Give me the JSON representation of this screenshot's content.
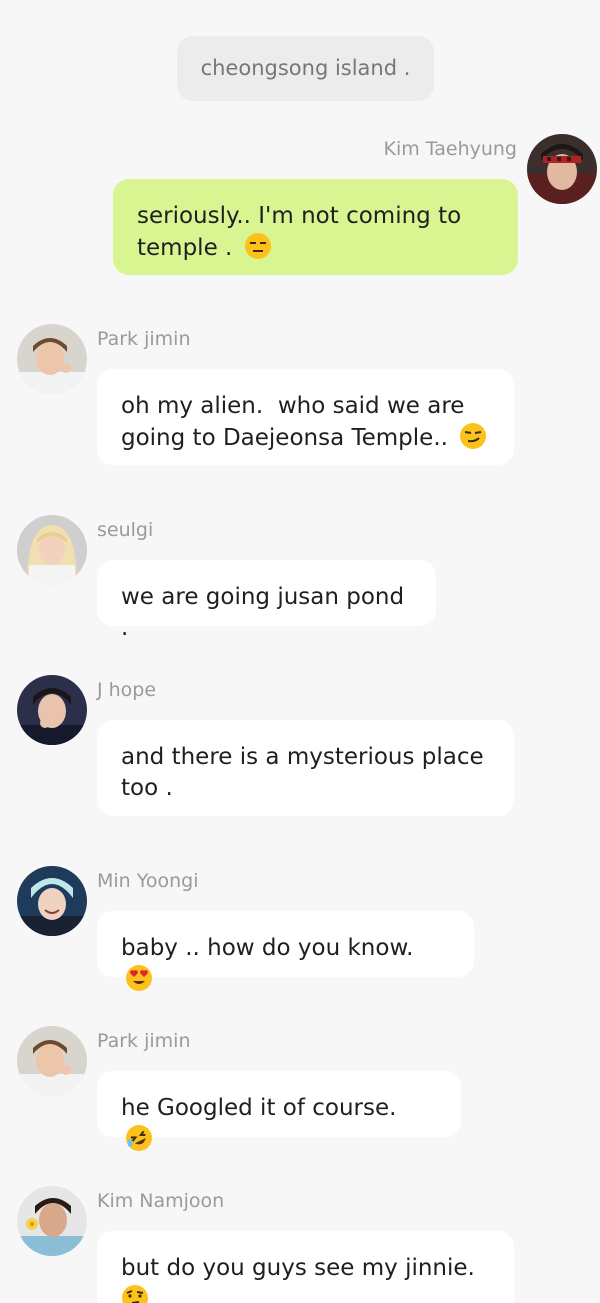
{
  "system_message": "cheongsong island .",
  "messages": [
    {
      "sender": "Kim Taehyung",
      "text": "seriously.. I'm not coming to\ntemple . ",
      "emoji": "expressionless-face-icon",
      "mine": true
    },
    {
      "sender": "Park jimin",
      "text": "oh my alien.  who said we are\ngoing to Daejeonsa Temple.. ",
      "emoji": "smirking-face-icon"
    },
    {
      "sender": "seulgi",
      "text": "we are going jusan pond ."
    },
    {
      "sender": "J hope",
      "text": "and there is a mysterious place\ntoo ."
    },
    {
      "sender": "Min Yoongi",
      "text": "baby .. how do you know.  ",
      "emoji": "heart-eyes-face-icon"
    },
    {
      "sender": "Park jimin",
      "text": "he Googled it of course.  ",
      "emoji": "rolling-laughing-face-icon"
    },
    {
      "sender": "Kim Namjoon",
      "text": "but do you guys see my jinnie.\n",
      "emoji": "thinking-face-icon"
    }
  ],
  "colors": {
    "background": "#f7f7f7",
    "own_bubble": "#d9f592",
    "other_bubble": "#ffffff",
    "sender_name": "#9a9a9a"
  }
}
